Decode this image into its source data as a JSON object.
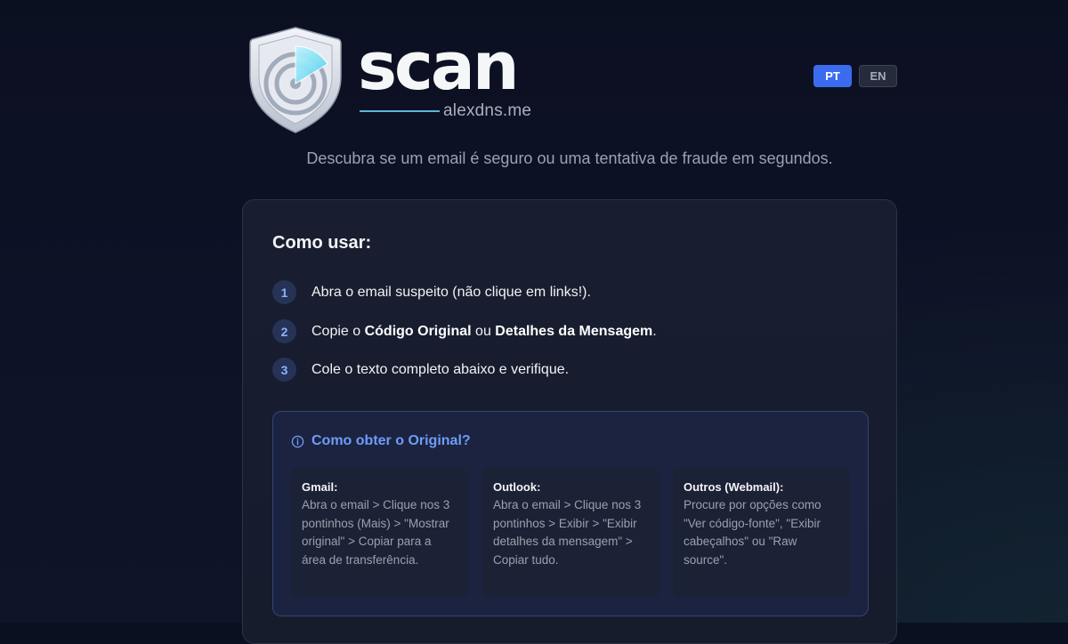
{
  "brand": {
    "wordmark": "scan",
    "domain": "alexdns.me"
  },
  "language": {
    "options": [
      "PT",
      "EN"
    ],
    "selected": "PT"
  },
  "tagline": "Descubra se um email é seguro ou uma tentativa de fraude em segundos.",
  "how_to": {
    "title": "Como usar:",
    "steps": [
      {
        "number": "1",
        "text": "Abra o email suspeito (não clique em links!)."
      },
      {
        "number": "2",
        "prefix": "Copie o ",
        "bold1": "Código Original",
        "middle": " ou ",
        "bold2": "Detalhes da Mensagem",
        "suffix": "."
      },
      {
        "number": "3",
        "text": "Cole o texto completo abaixo e verifique."
      }
    ]
  },
  "original_help": {
    "title": "Como obter o Original?",
    "icon": "info-icon",
    "providers": [
      {
        "name": "Gmail:",
        "instructions": "Abra o email > Clique nos 3 pontinhos (Mais) > \"Mostrar original\" > Copiar para a área de transferência."
      },
      {
        "name": "Outlook:",
        "instructions": "Abra o email > Clique nos 3 pontinhos > Exibir > \"Exibir detalhes da mensagem\" > Copiar tudo."
      },
      {
        "name": "Outros (Webmail):",
        "instructions": "Procure por opções como \"Ver código-fonte\", \"Exibir cabeçalhos\" ou \"Raw source\"."
      }
    ]
  },
  "colors": {
    "accent": "#3b6cf0",
    "info_title": "#6f9cf6",
    "step_badge": "#263357"
  }
}
